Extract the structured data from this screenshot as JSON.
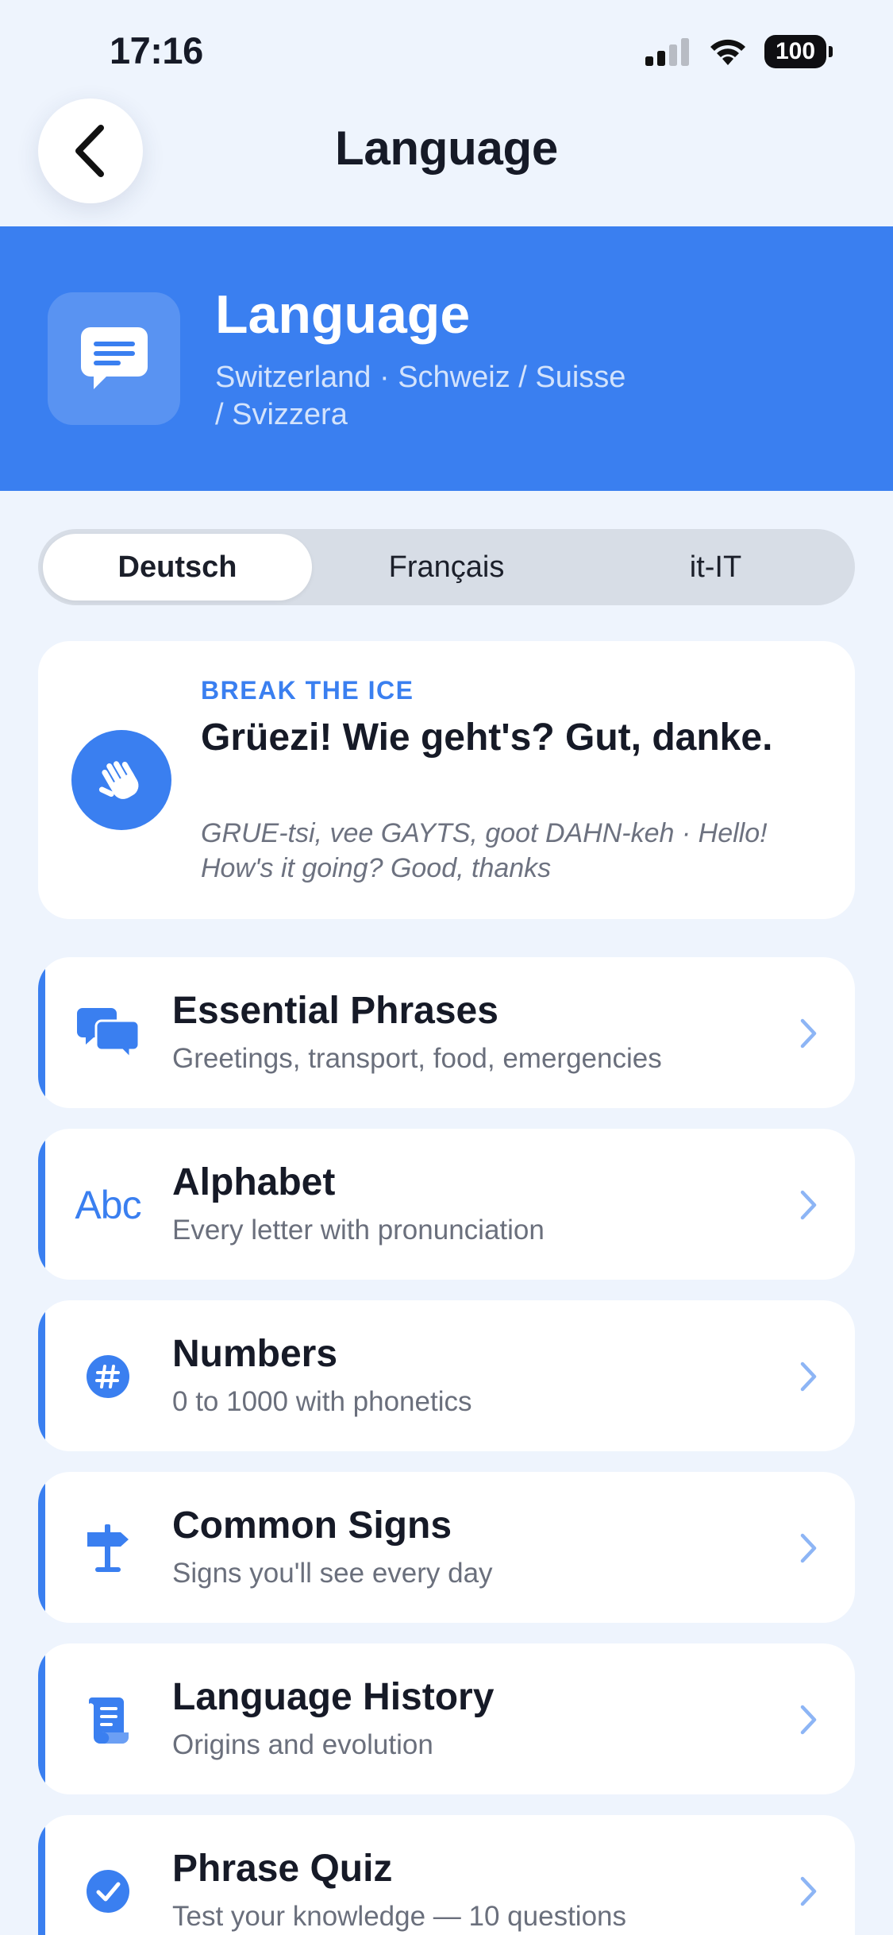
{
  "status_bar": {
    "time": "17:16",
    "battery": "100"
  },
  "nav": {
    "title": "Language",
    "back_icon": "chevron-left-icon"
  },
  "hero": {
    "title": "Language",
    "subtitle": "Switzerland · Schweiz / Suisse / Svizzera",
    "icon": "speech-bubble-icon"
  },
  "language_tabs": {
    "selected": "Deutsch",
    "items": [
      "Deutsch",
      "Français",
      "it-IT"
    ]
  },
  "ice_breaker": {
    "label": "BREAK THE ICE",
    "phrase": "Grüezi! Wie geht's? Gut, danke.",
    "phonetic": "GRUE-tsi, vee GAYTS, goot DAHN-keh · Hello! How's it going? Good, thanks",
    "icon": "waving-hand-icon"
  },
  "menu": [
    {
      "title": "Essential Phrases",
      "subtitle": "Greetings, transport, food, emergencies",
      "icon": "chat-bubbles-icon"
    },
    {
      "title": "Alphabet",
      "subtitle": "Every letter with pronunciation",
      "icon_text": "Abc"
    },
    {
      "title": "Numbers",
      "subtitle": "0 to 1000 with phonetics",
      "icon": "number-sign-icon"
    },
    {
      "title": "Common Signs",
      "subtitle": "Signs you'll see every day",
      "icon": "signpost-icon"
    },
    {
      "title": "Language History",
      "subtitle": "Origins and evolution",
      "icon": "scroll-icon"
    },
    {
      "title": "Phrase Quiz",
      "subtitle": "Test your knowledge — 10 questions",
      "icon": "checkmark-circle-icon"
    }
  ],
  "colors": {
    "accent": "#3A7FF0",
    "background": "#EEF4FD",
    "card": "#FFFFFF",
    "text": "#161A27",
    "muted": "#6A6F7C"
  }
}
